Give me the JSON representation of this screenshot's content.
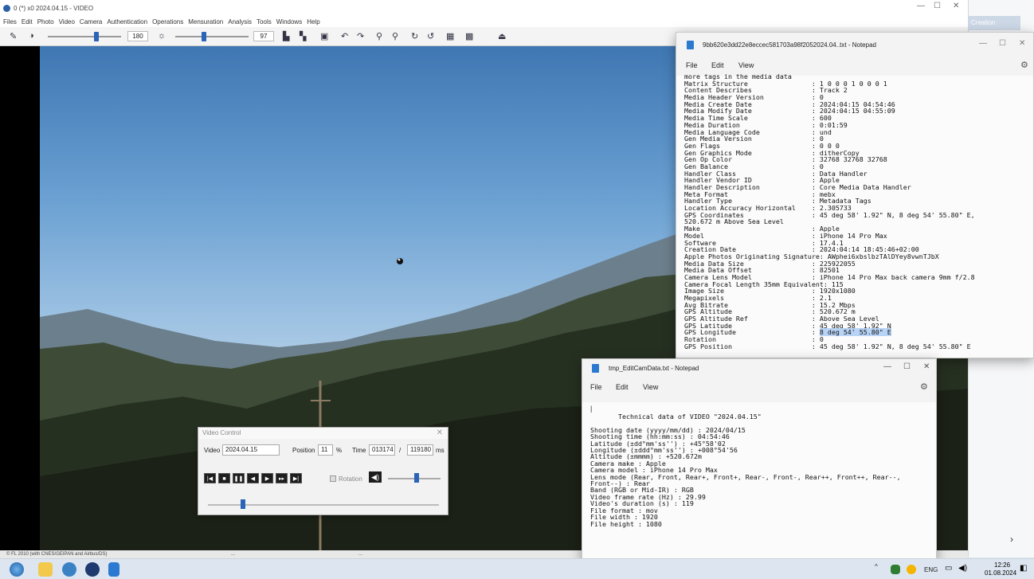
{
  "app": {
    "title": "0 (*) x0 2024.04.15 - VIDEO",
    "menu": [
      "Files",
      "Edit",
      "Photo",
      "Video",
      "Camera",
      "Authentication",
      "Operations",
      "Mensuration",
      "Analysis",
      "Tools",
      "Windows",
      "Help"
    ],
    "slider1_value": "180",
    "slider2_value": "97",
    "status_text": "© FL 2010 (with CNES/GEIPAN and Airbus/DS)",
    "status_mid1": "...",
    "status_mid2": "...",
    "right_pane_label": "Creation"
  },
  "video_control": {
    "title": "Video Control",
    "video_label": "Video",
    "video_value": "2024.04.15",
    "position_label": "Position",
    "position_value": "11",
    "percent": "%",
    "time_label": "Time",
    "time_value": "013174",
    "slash": "/",
    "total_value": "119180",
    "ms": "ms",
    "rotation_label": "Rotation",
    "position_slider": 0.15,
    "volume_slider": 0.55
  },
  "notepad1": {
    "title": "9bb620e3dd22e8eccec581703a98f2052024.04..txt - Notepad",
    "menu": [
      "File",
      "Edit",
      "View"
    ],
    "lines": [
      "more tags in the media data",
      "Matrix Structure                : 1 0 0 0 1 0 0 0 1",
      "Content Describes               : Track 2",
      "Media Header Version            : 0",
      "Media Create Date               : 2024:04:15 04:54:46",
      "Media Modify Date               : 2024:04:15 04:55:09",
      "Media Time Scale                : 600",
      "Media Duration                  : 0:01:59",
      "Media Language Code             : und",
      "Gen Media Version               : 0",
      "Gen Flags                       : 0 0 0",
      "Gen Graphics Mode               : ditherCopy",
      "Gen Op Color                    : 32768 32768 32768",
      "Gen Balance                     : 0",
      "Handler Class                   : Data Handler",
      "Handler Vendor ID               : Apple",
      "Handler Description             : Core Media Data Handler",
      "Meta Format                     : mebx",
      "Handler Type                    : Metadata Tags",
      "Location Accuracy Horizontal    : 2.305733",
      "GPS Coordinates                 : 45 deg 58' 1.92\" N, 8 deg 54' 55.80\" E,",
      "520.672 m Above Sea Level",
      "Make                            : Apple",
      "Model                           : iPhone 14 Pro Max",
      "Software                        : 17.4.1",
      "Creation Date                   : 2024:04:14 18:45:46+02:00",
      "Apple Photos Originating Signature: AWphei6xbslbzTAlDYey8vwnTJbX",
      "Media Data Size                 : 225922055",
      "Media Data Offset               : 82501",
      "Camera Lens Model               : iPhone 14 Pro Max back camera 9mm f/2.8",
      "Camera Focal Length 35mm Equivalent: 115",
      "Image Size                      : 1920x1080",
      "Megapixels                      : 2.1",
      "Avg Bitrate                     : 15.2 Mbps",
      "GPS Altitude                    : 520.672 m",
      "GPS Altitude Ref                : Above Sea Level",
      "GPS Latitude                    : 45 deg 58' 1.92\" N",
      "GPS Longitude                   : ",
      "Rotation                        : 0",
      "GPS Position                    : 45 deg 58' 1.92\" N, 8 deg 54' 55.80\" E"
    ],
    "selected_text": "8 deg 54' 55.80\" E"
  },
  "notepad2": {
    "title": "tmp_EditCamData.txt - Notepad",
    "menu": [
      "File",
      "Edit",
      "View"
    ],
    "cursor": "|",
    "lines": [
      "       Technical data of VIDEO \"2024.04.15\"",
      "",
      "Shooting date (yyyy/mm/dd) : 2024/04/15",
      "Shooting time (hh:mm:ss) : 04:54:46",
      "Latitude (±dd°mm'ss'') : +45°58'02",
      "Longitude (±ddd°mm'ss'') : +008°54'56",
      "Altitude (±mmmm) : +520.672m",
      "Camera make : Apple",
      "Camera model : iPhone 14 Pro Max",
      "Lens mode (Rear, Front, Rear+, Front+, Rear-, Front-, Rear++, Front++, Rear--,",
      "Front--) : Rear",
      "Band (RGB or Mid-IR) : RGB",
      "Video frame rate (Hz) : 29.99",
      "Video's duration (s) : 119",
      "File format : mov",
      "File width : 1920",
      "File height : 1080"
    ]
  },
  "taskbar": {
    "lang": "ENG",
    "time": "12:26",
    "date": "01.08.2024"
  }
}
